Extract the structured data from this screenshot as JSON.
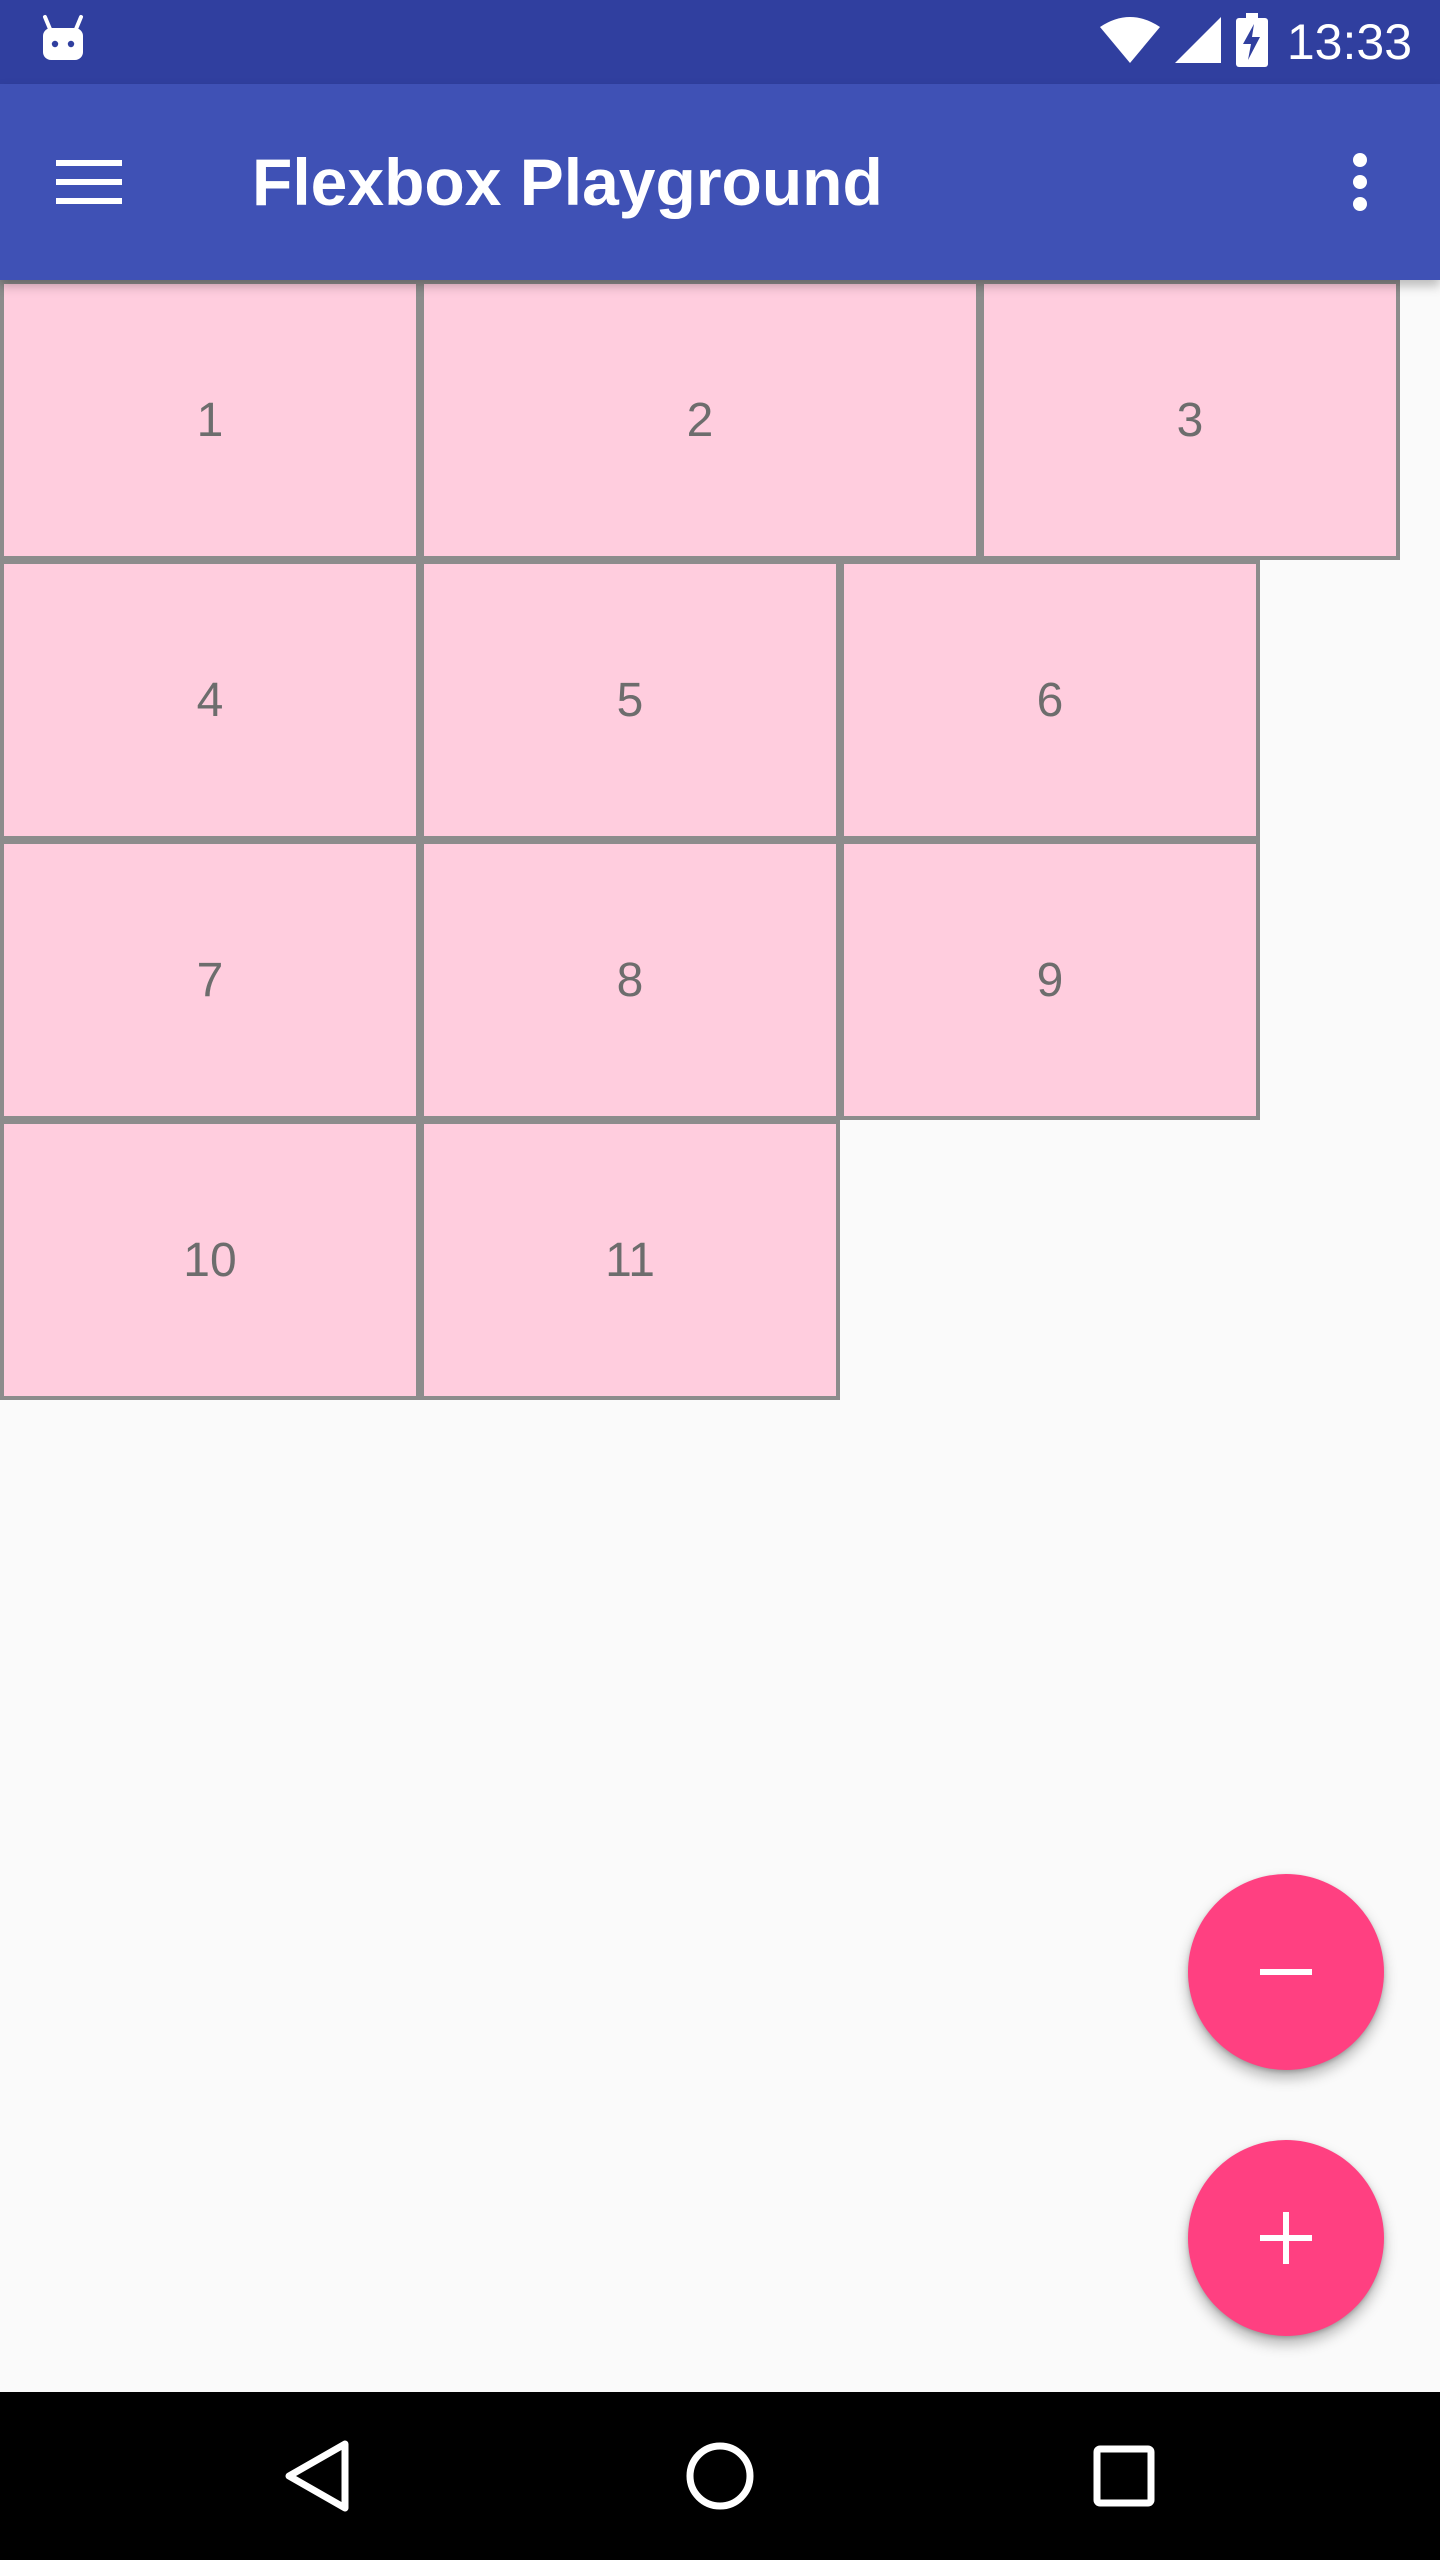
{
  "status_bar": {
    "time": "13:33",
    "icons": [
      "android-notification-icon",
      "wifi-icon",
      "signal-icon",
      "battery-charging-icon"
    ]
  },
  "app_bar": {
    "title": "Flexbox Playground",
    "menu_icon": "hamburger-menu-icon",
    "overflow_icon": "more-vert-icon"
  },
  "flex_items": [
    "1",
    "2",
    "3",
    "4",
    "5",
    "6",
    "7",
    "8",
    "9",
    "10",
    "11"
  ],
  "fab": {
    "remove_icon": "minus-icon",
    "add_icon": "plus-icon"
  },
  "nav_bar": {
    "icons": [
      "back-icon",
      "home-icon",
      "recents-icon"
    ]
  },
  "colors": {
    "status_bar": "#303f9f",
    "app_bar": "#3f51b5",
    "flex_item_fill": "#ffcdde",
    "flex_item_border": "#8c8c8c",
    "fab": "#ff4081",
    "background": "#fafafa"
  }
}
